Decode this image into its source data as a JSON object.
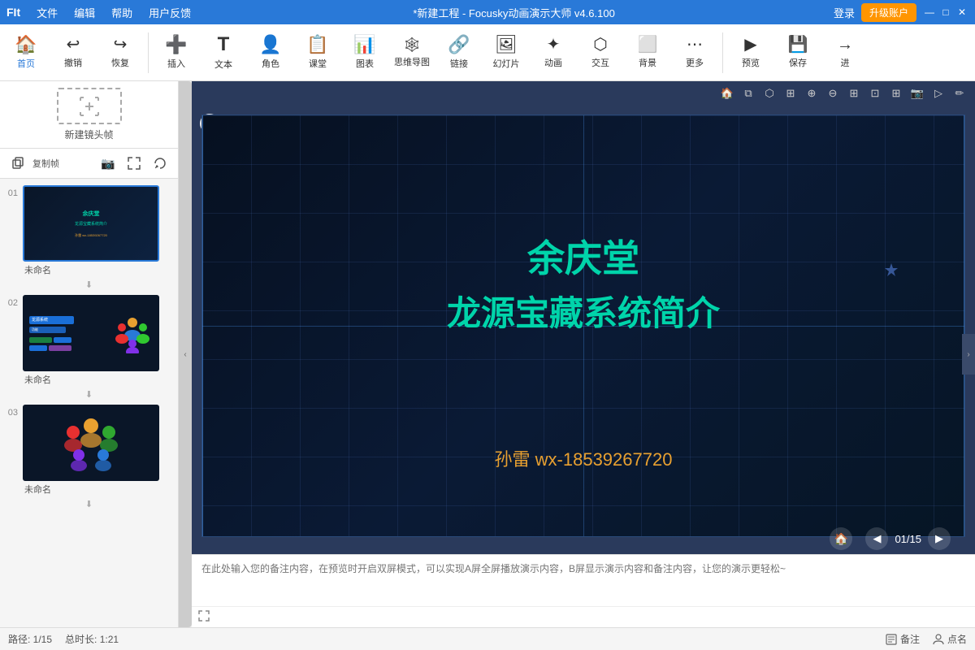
{
  "titlebar": {
    "logo": "FIt",
    "title": "*新建工程 - Focusky动画演示大师  v4.6.100",
    "menu": [
      "文件",
      "编辑",
      "帮助",
      "用户反馈"
    ],
    "login": "登录",
    "upgrade": "升级账户",
    "window_controls": [
      "—",
      "□",
      "✕"
    ]
  },
  "toolbar": {
    "items": [
      {
        "id": "home",
        "icon": "🏠",
        "label": "首页"
      },
      {
        "id": "undo",
        "icon": "↩",
        "label": "撤销"
      },
      {
        "id": "redo",
        "icon": "↪",
        "label": "恢复"
      },
      {
        "id": "insert",
        "icon": "➕",
        "label": "插入"
      },
      {
        "id": "text",
        "icon": "T",
        "label": "文本"
      },
      {
        "id": "character",
        "icon": "👤",
        "label": "角色"
      },
      {
        "id": "classroom",
        "icon": "📋",
        "label": "课堂"
      },
      {
        "id": "chart",
        "icon": "📊",
        "label": "图表"
      },
      {
        "id": "mindmap",
        "icon": "🕸",
        "label": "思维导图"
      },
      {
        "id": "link",
        "icon": "🔗",
        "label": "链接"
      },
      {
        "id": "slideshow",
        "icon": "🖼",
        "label": "幻灯片"
      },
      {
        "id": "animation",
        "icon": "✨",
        "label": "动画"
      },
      {
        "id": "interact",
        "icon": "🖱",
        "label": "交互"
      },
      {
        "id": "background",
        "icon": "🖼",
        "label": "背景"
      },
      {
        "id": "more",
        "icon": "⋯",
        "label": "更多"
      },
      {
        "id": "preview",
        "icon": "▶",
        "label": "预览"
      },
      {
        "id": "save",
        "icon": "💾",
        "label": "保存"
      },
      {
        "id": "next",
        "icon": "→",
        "label": "进"
      }
    ]
  },
  "left_panel": {
    "new_frame_label": "新建镜头帧",
    "frame_tools": [
      "复制帧",
      "📷",
      "↔",
      "↩"
    ],
    "slides": [
      {
        "number": "01",
        "label": "未命名",
        "active": true,
        "type": "title"
      },
      {
        "number": "02",
        "label": "未命名",
        "active": false,
        "type": "diagram"
      },
      {
        "number": "03",
        "label": "未命名",
        "active": false,
        "type": "people"
      }
    ]
  },
  "slide": {
    "title": "余庆堂",
    "subtitle": "龙源宝藏系统简介",
    "author": "孙雷   wx-18539267720",
    "frame_number": "1"
  },
  "canvas_tools": [
    "🏠",
    "⧉",
    "⊕",
    "⊖",
    "⊞",
    "⊡",
    "⊞",
    "⊡",
    "⊞",
    "📷",
    "▷",
    "✏"
  ],
  "navigation": {
    "current": "01/15",
    "home_icon": "🏠",
    "prev_icon": "◀",
    "next_icon": "▶"
  },
  "notes": {
    "placeholder": "在此处输入您的备注内容，在预览时开启双屏模式，可以实现A屏全屏播放演示内容，B屏显示演示内容和备注内容，让您的演示更轻松~"
  },
  "statusbar": {
    "path": "路径: 1/15",
    "duration": "总时长: 1:21",
    "notes_label": "备注",
    "callname_label": "点名"
  }
}
